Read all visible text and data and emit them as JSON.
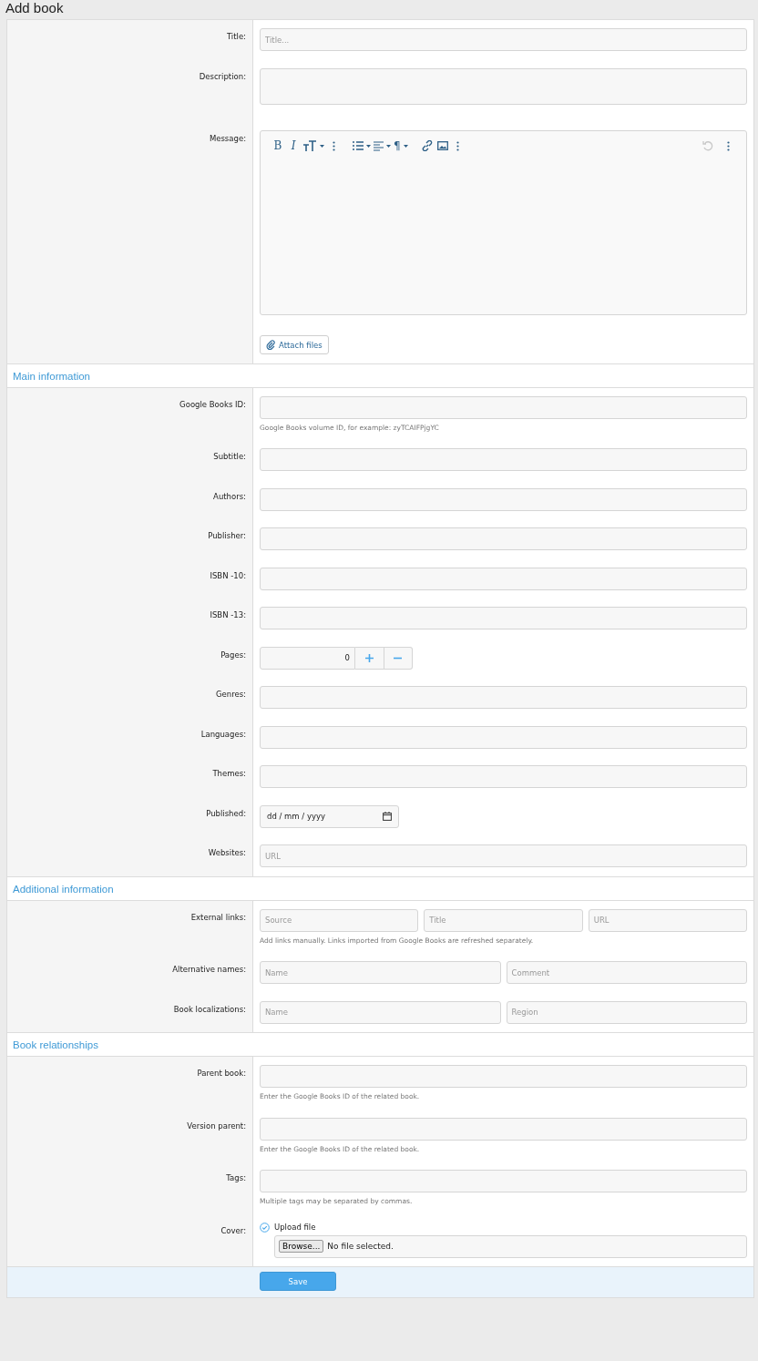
{
  "page_title": "Add book",
  "sections": [
    {
      "rows": [
        {
          "kind": "text",
          "label": "Title:",
          "placeholder": "Title..."
        },
        {
          "kind": "textarea",
          "label": "Description:"
        },
        {
          "kind": "editor",
          "label": "Message:",
          "toolbar": {
            "groups": [
              [
                {
                  "kind": "bold",
                  "text": "B",
                  "dropdown": false,
                  "disabled": false
                },
                {
                  "kind": "italic",
                  "text": "I",
                  "dropdown": false,
                  "disabled": false
                },
                {
                  "kind": "size",
                  "dropdown": true,
                  "disabled": false
                },
                {
                  "kind": "more",
                  "dropdown": false,
                  "disabled": false
                }
              ],
              [
                {
                  "kind": "list",
                  "dropdown": true,
                  "disabled": false
                },
                {
                  "kind": "align",
                  "dropdown": true,
                  "disabled": false
                },
                {
                  "kind": "paragraph",
                  "text": "¶",
                  "dropdown": true,
                  "disabled": false
                }
              ],
              [
                {
                  "kind": "link",
                  "dropdown": false,
                  "disabled": false
                },
                {
                  "kind": "image",
                  "dropdown": false,
                  "disabled": false
                },
                {
                  "kind": "more",
                  "dropdown": false,
                  "disabled": false
                }
              ]
            ],
            "end": [
              {
                "kind": "undo",
                "dropdown": false,
                "disabled": true
              },
              {
                "kind": "more",
                "dropdown": false,
                "disabled": false
              }
            ]
          },
          "attach_button": "Attach files"
        }
      ]
    },
    {
      "heading": "Main information",
      "rows": [
        {
          "kind": "text",
          "label": "Google Books ID:",
          "hint": "Google Books volume ID, for example: zyTCAIFPjgYC"
        },
        {
          "kind": "text",
          "label": "Subtitle:"
        },
        {
          "kind": "text",
          "label": "Authors:"
        },
        {
          "kind": "text",
          "label": "Publisher:"
        },
        {
          "kind": "text",
          "label": "ISBN -10:"
        },
        {
          "kind": "text",
          "label": "ISBN -13:"
        },
        {
          "kind": "number",
          "label": "Pages:",
          "value": "0"
        },
        {
          "kind": "text",
          "label": "Genres:"
        },
        {
          "kind": "text",
          "label": "Languages:"
        },
        {
          "kind": "text",
          "label": "Themes:"
        },
        {
          "kind": "date",
          "label": "Published:",
          "value": "dd / mm / yyyy"
        },
        {
          "kind": "text",
          "label": "Websites:",
          "placeholder": "URL"
        }
      ]
    },
    {
      "heading": "Additional information",
      "rows": [
        {
          "kind": "multi",
          "label": "External links:",
          "fields": [
            {
              "placeholder": "Source"
            },
            {
              "placeholder": "Title"
            },
            {
              "placeholder": "URL"
            }
          ],
          "hint": "Add links manually. Links imported from Google Books are refreshed separately."
        },
        {
          "kind": "multi",
          "label": "Alternative names:",
          "fields": [
            {
              "placeholder": "Name"
            },
            {
              "placeholder": "Comment"
            }
          ]
        },
        {
          "kind": "multi",
          "label": "Book localizations:",
          "fields": [
            {
              "placeholder": "Name"
            },
            {
              "placeholder": "Region"
            }
          ]
        }
      ]
    },
    {
      "heading": "Book relationships",
      "rows": [
        {
          "kind": "text",
          "label": "Parent book:",
          "hint": "Enter the Google Books ID of the related book."
        },
        {
          "kind": "text",
          "label": "Version parent:",
          "hint": "Enter the Google Books ID of the related book."
        },
        {
          "kind": "text",
          "label": "Tags:",
          "hint": "Multiple tags may be separated by commas."
        },
        {
          "kind": "file",
          "label": "Cover:",
          "option": "Upload file",
          "browse": "Browse...",
          "status": "No file selected."
        }
      ]
    }
  ],
  "save_button": "Save"
}
